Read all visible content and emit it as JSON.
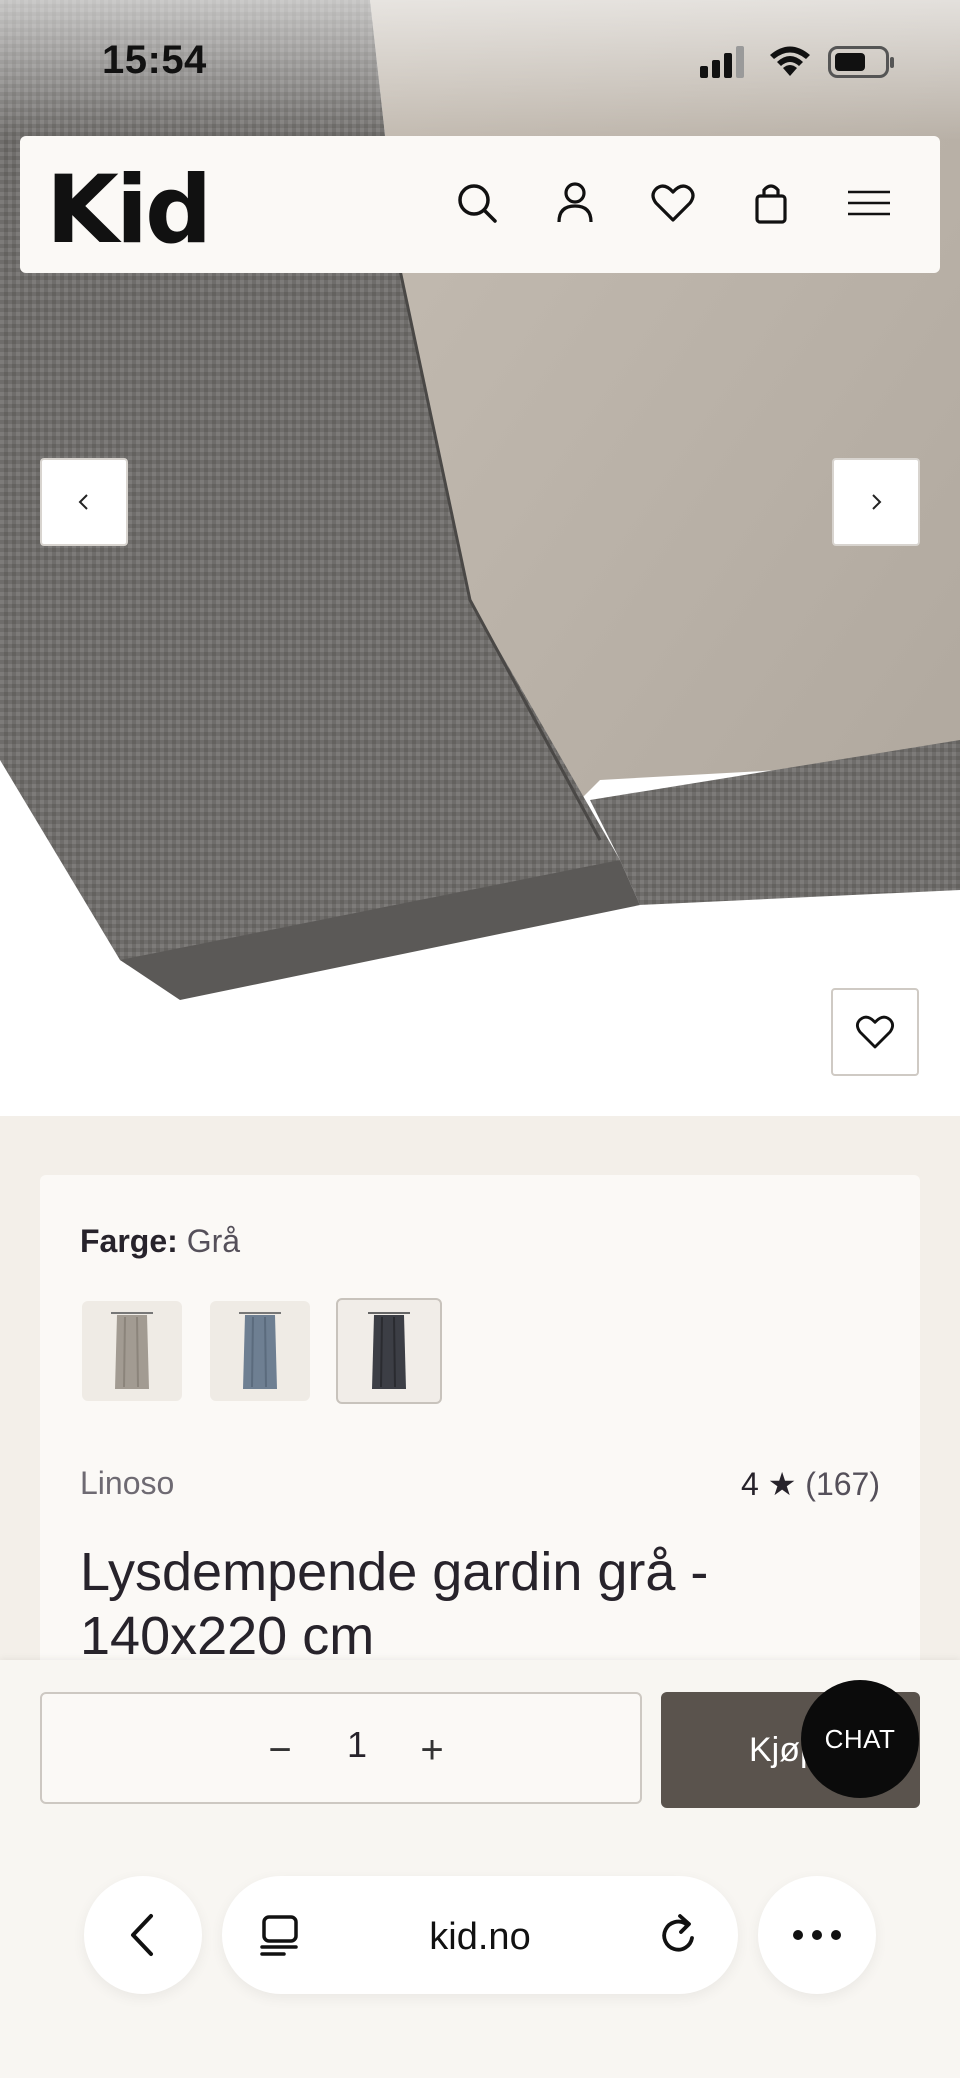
{
  "status_bar": {
    "time": "15:54"
  },
  "header": {
    "logo": "Kid",
    "icons": [
      "search-icon",
      "account-icon",
      "wishlist-icon",
      "cart-icon",
      "menu-icon"
    ]
  },
  "gallery": {
    "prev_icon": "chevron-left-icon",
    "next_icon": "chevron-right-icon",
    "favorite_icon": "heart-icon"
  },
  "product": {
    "color_label": "Farge:",
    "color_value": "Grå",
    "swatches": [
      {
        "name": "beige",
        "color": "#a29b92"
      },
      {
        "name": "blue",
        "color": "#6e7f92"
      },
      {
        "name": "grey",
        "color": "#3c3e45",
        "selected": true
      }
    ],
    "brand": "Linoso",
    "rating": "4",
    "rating_star": "★",
    "review_count": "(167)",
    "title": "Lysdempende gardin grå - 140x220 cm"
  },
  "purchase": {
    "quantity": "1",
    "minus_symbol": "−",
    "plus_symbol": "+",
    "buy_label": "Kjøp",
    "chat_label": "CHAT"
  },
  "browser": {
    "url": "kid.no",
    "back_icon": "back-icon",
    "tabs_icon": "tabs-icon",
    "reload_icon": "reload-icon",
    "more_icon": "more-icon"
  }
}
